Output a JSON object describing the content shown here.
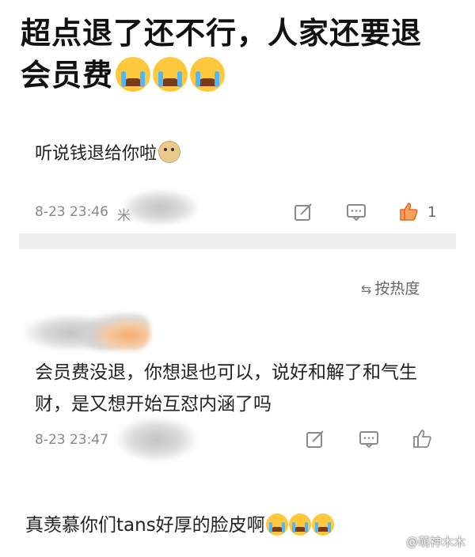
{
  "post": {
    "title_line1": "超点退了还不行，人家还要退",
    "title_line2": "会员费",
    "title_emojis": [
      "loudly-crying-face",
      "loudly-crying-face",
      "loudly-crying-face"
    ]
  },
  "comments": [
    {
      "text": "听说钱退给你啦",
      "emoji": "doge-face",
      "time": "8-23 23:46",
      "author_visible_fragment": "米",
      "like_count": "1",
      "liked": true,
      "like_color": "#e8652a"
    },
    {
      "text": "会员费没退，你想退也可以，说好和解了和气生财，是又想开始互怼内涵了吗",
      "time": "8-23 23:47",
      "liked": false
    },
    {
      "text": "真羡慕你们tans好厚的脸皮啊",
      "emojis": [
        "loudly-crying-face",
        "loudly-crying-face",
        "loudly-crying-face"
      ]
    }
  ],
  "sort": {
    "label": "按热度",
    "icon": "sort-icon"
  },
  "watermark": "@萌神木木",
  "colors": {
    "icon_gray": "#8a8a8a",
    "like_active": "#e8652a",
    "divider": "#efefef"
  }
}
